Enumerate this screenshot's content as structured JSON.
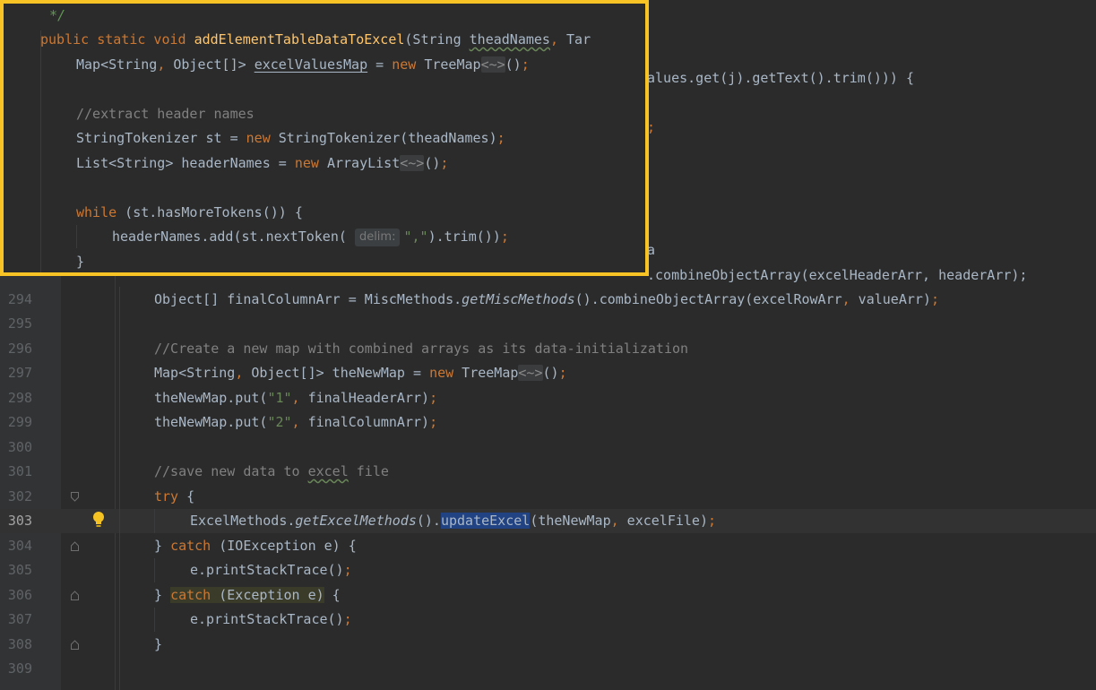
{
  "editor": {
    "lines": [
      {
        "num": "294",
        "code": "Object[] finalColumnArr = MiscMethods.getMiscMethods().combineObjectArray(excelRowArr, valueArr);"
      },
      {
        "num": "295",
        "code": ""
      },
      {
        "num": "296",
        "code": "//Create a new map with combined arrays as its data-initialization"
      },
      {
        "num": "297",
        "code": "Map<String, Object[]> theNewMap = new TreeMap<~>();"
      },
      {
        "num": "298",
        "code": "theNewMap.put(\"1\", finalHeaderArr);"
      },
      {
        "num": "299",
        "code": "theNewMap.put(\"2\", finalColumnArr);"
      },
      {
        "num": "300",
        "code": ""
      },
      {
        "num": "301",
        "code": "//save new data to excel file"
      },
      {
        "num": "302",
        "code": "try {"
      },
      {
        "num": "303",
        "code": "ExcelMethods.getExcelMethods().updateExcel(theNewMap, excelFile);"
      },
      {
        "num": "304",
        "code": "} catch (IOException e) {"
      },
      {
        "num": "305",
        "code": "e.printStackTrace();"
      },
      {
        "num": "306",
        "code": "} catch (Exception e) {"
      },
      {
        "num": "307",
        "code": "e.printStackTrace();"
      },
      {
        "num": "308",
        "code": "}"
      },
      {
        "num": "309",
        "code": ""
      }
    ],
    "background_fragments": {
      "frag_values": "alues.get(j).getText().trim())) {",
      "frag_brace": ";",
      "frag_a": "a",
      "frag_combine": ".combineObjectArray(excelHeaderArr, headerArr);"
    },
    "highlighted_method": "updateExcel",
    "current_line": "303"
  },
  "peek_popup": {
    "lines": [
      "*/",
      "public static void addElementTableDataToExcel(String theadNames, Tar",
      "Map<String, Object[]> excelValuesMap = new TreeMap<~>();",
      "",
      "//extract header names",
      "StringTokenizer st = new StringTokenizer(theadNames);",
      "List<String> headerNames = new ArrayList<~>();",
      "",
      "while (st.hasMoreTokens()) {",
      "headerNames.add(st.nextToken( delim: \",\").trim());",
      "}"
    ],
    "param_hint": "delim:",
    "border_color": "#f7c325"
  },
  "colors": {
    "background": "#2b2b2b",
    "keyword": "#cc7832",
    "method_decl": "#ffc66d",
    "string": "#6a8759",
    "comment": "#808080",
    "text": "#a9b7c6",
    "selection": "#214283"
  }
}
